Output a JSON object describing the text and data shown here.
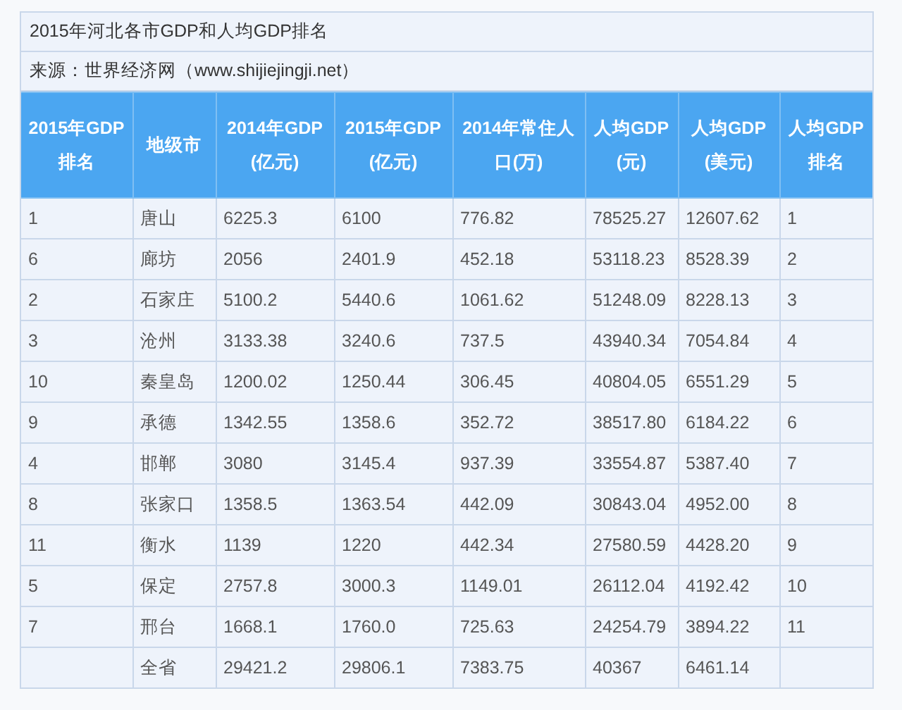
{
  "title": "2015年河北各市GDP和人均GDP排名",
  "source": "来源：世界经济网（www.shijiejingji.net）",
  "table": {
    "columns": [
      "2015年GDP排名",
      "地级市",
      "2014年GDP(亿元)",
      "2015年GDP(亿元)",
      "2014年常住人口(万)",
      "人均GDP(元)",
      "人均GDP(美元)",
      "人均GDP排名"
    ],
    "rows": [
      [
        "1",
        "唐山",
        "6225.3",
        "6100",
        "776.82",
        "78525.27",
        "12607.62",
        "1"
      ],
      [
        "6",
        "廊坊",
        "2056",
        "2401.9",
        "452.18",
        "53118.23",
        "8528.39",
        "2"
      ],
      [
        "2",
        "石家庄",
        "5100.2",
        "5440.6",
        "1061.62",
        "51248.09",
        "8228.13",
        "3"
      ],
      [
        "3",
        "沧州",
        "3133.38",
        "3240.6",
        "737.5",
        "43940.34",
        "7054.84",
        "4"
      ],
      [
        "10",
        "秦皇岛",
        "1200.02",
        "1250.44",
        "306.45",
        "40804.05",
        "6551.29",
        "5"
      ],
      [
        "9",
        "承德",
        "1342.55",
        "1358.6",
        "352.72",
        "38517.80",
        "6184.22",
        "6"
      ],
      [
        "4",
        "邯郸",
        "3080",
        "3145.4",
        "937.39",
        "33554.87",
        "5387.40",
        "7"
      ],
      [
        "8",
        "张家口",
        "1358.5",
        "1363.54",
        "442.09",
        "30843.04",
        "4952.00",
        "8"
      ],
      [
        "11",
        "衡水",
        "1139",
        "1220",
        "442.34",
        "27580.59",
        "4428.20",
        "9"
      ],
      [
        "5",
        "保定",
        "2757.8",
        "3000.3",
        "1149.01",
        "26112.04",
        "4192.42",
        "10"
      ],
      [
        "7",
        "邢台",
        "1668.1",
        "1760.0",
        "725.63",
        "24254.79",
        "3894.22",
        "11"
      ],
      [
        "",
        "全省",
        "29421.2",
        "29806.1",
        "7383.75",
        "40367",
        "6461.14",
        ""
      ]
    ]
  }
}
